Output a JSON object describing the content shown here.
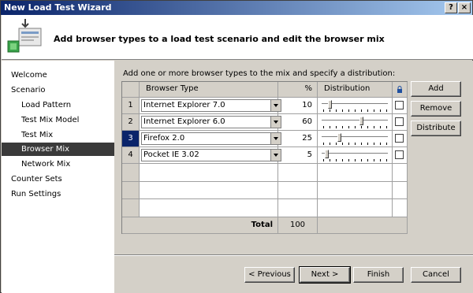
{
  "window": {
    "title": "New Load Test Wizard",
    "help_label": "?",
    "close_label": "×"
  },
  "header": {
    "title": "Add browser types to a load test scenario and edit the browser mix",
    "icon": "wizard-icon"
  },
  "nav": {
    "items": [
      {
        "label": "Welcome",
        "level": 0
      },
      {
        "label": "Scenario",
        "level": 0
      },
      {
        "label": "Load Pattern",
        "level": 1
      },
      {
        "label": "Test Mix Model",
        "level": 1
      },
      {
        "label": "Test Mix",
        "level": 1
      },
      {
        "label": "Browser Mix",
        "level": 1,
        "selected": true
      },
      {
        "label": "Network Mix",
        "level": 1
      },
      {
        "label": "Counter Sets",
        "level": 0
      },
      {
        "label": "Run Settings",
        "level": 0
      }
    ]
  },
  "content": {
    "instruction": "Add one or more browser types to the mix and specify a distribution:",
    "columns": {
      "browser": "Browser Type",
      "percent": "%",
      "distribution": "Distribution"
    },
    "rows": [
      {
        "num": "1",
        "browser": "Internet Explorer 7.0",
        "percent": "10",
        "fraction": 0.1
      },
      {
        "num": "2",
        "browser": "Internet Explorer 6.0",
        "percent": "60",
        "fraction": 0.6
      },
      {
        "num": "3",
        "browser": "Firefox 2.0",
        "percent": "25",
        "fraction": 0.25,
        "selected": true
      },
      {
        "num": "4",
        "browser": "Pocket IE 3.02",
        "percent": "5",
        "fraction": 0.05
      }
    ],
    "total_label": "Total",
    "total_value": "100",
    "buttons": {
      "add": "Add",
      "remove": "Remove",
      "distribute": "Distribute"
    }
  },
  "footer": {
    "previous": "< Previous",
    "next": "Next >",
    "finish": "Finish",
    "cancel": "Cancel"
  },
  "colors": {
    "title_start": "#0a246a",
    "title_end": "#a6caf0",
    "selection": "#0a246a",
    "nav_selected": "#3a3a3a"
  }
}
